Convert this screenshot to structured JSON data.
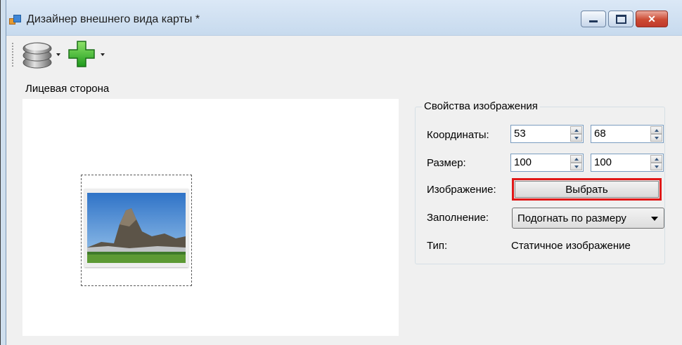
{
  "window": {
    "title": "Дизайнер внешнего вида карты *",
    "controls": {
      "minimize": "minimize",
      "maximize": "maximize",
      "close": "close"
    }
  },
  "toolbar": {
    "items": [
      {
        "icon": "database-icon",
        "has_dropdown": true
      },
      {
        "icon": "add-plus-icon",
        "has_dropdown": true
      }
    ]
  },
  "canvas": {
    "label": "Лицевая сторона"
  },
  "properties": {
    "group_title": "Свойства изображения",
    "coordinates_label": "Координаты:",
    "coord_x": "53",
    "coord_y": "68",
    "size_label": "Размер:",
    "size_w": "100",
    "size_h": "100",
    "image_label": "Изображение:",
    "choose_button": "Выбрать",
    "fill_label": "Заполнение:",
    "fill_value": "Подогнать по размеру",
    "type_label": "Тип:",
    "type_value": "Статичное изображение"
  },
  "colors": {
    "highlight_border": "#e01818",
    "titlebar": "#c7daee",
    "close_button": "#cc4a33"
  }
}
